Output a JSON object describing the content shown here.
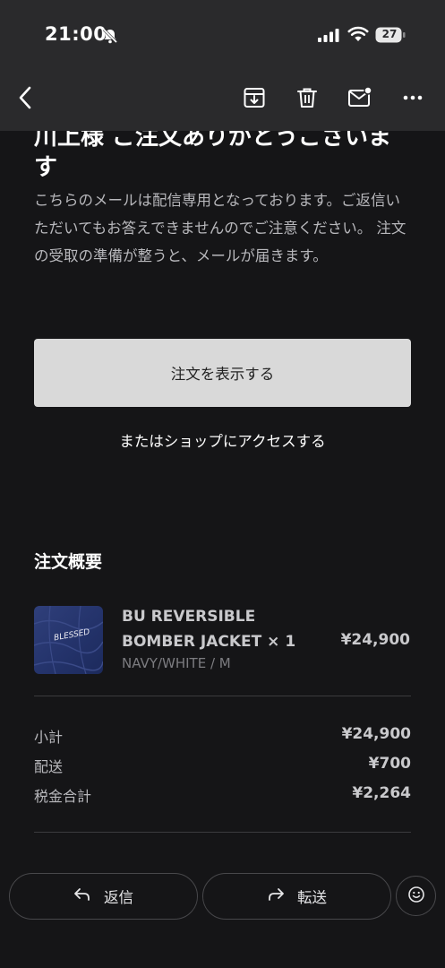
{
  "status_bar": {
    "time": "21:00",
    "battery": "27"
  },
  "toolbar": {
    "icons": [
      "back-chevron-icon",
      "archive-icon",
      "trash-icon",
      "mark-unread-icon",
      "more-icon"
    ]
  },
  "email": {
    "headline": "川上様 ご注文ありがとうございます",
    "notice": "こちらのメールは配信専用となっております。ご返信いただいてもお答えできませんのでご注意ください。 注文の受取の準備が整うと、メールが届きます。",
    "view_order_button": "注文を表示する",
    "shop_link": "またはショップにアクセスする",
    "summary_title": "注文概要",
    "item": {
      "name": "BU REVERSIBLE BOMBER JACKET × 1",
      "variant": "NAVY/WHITE / M",
      "price": "¥24,900",
      "thumb_text": "BLESSED"
    },
    "totals": [
      {
        "label": "小計",
        "value": "¥24,900"
      },
      {
        "label": "配送",
        "value": "¥700"
      },
      {
        "label": "税金合計",
        "value": "¥2,264"
      }
    ]
  },
  "bottom_bar": {
    "reply_label": "返信",
    "forward_label": "転送"
  },
  "colors": {
    "background": "#151517",
    "header": "#2a2a2c",
    "button_bg": "#d9d9d9",
    "muted_text": "#b8b8bc"
  }
}
